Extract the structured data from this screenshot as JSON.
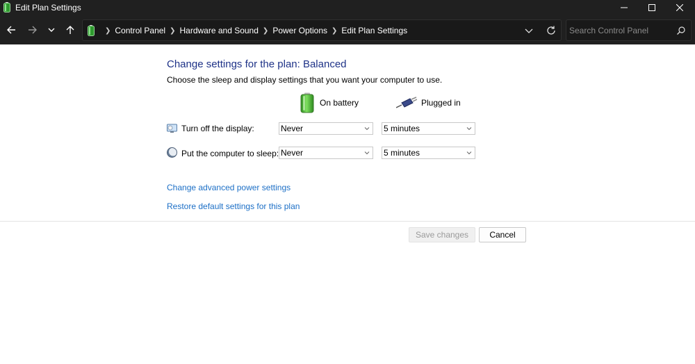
{
  "window": {
    "title": "Edit Plan Settings",
    "icon": "battery-plan-icon"
  },
  "nav": {
    "breadcrumbs": [
      "Control Panel",
      "Hardware and Sound",
      "Power Options",
      "Edit Plan Settings"
    ],
    "search_placeholder": "Search Control Panel"
  },
  "content": {
    "heading": "Change settings for the plan: Balanced",
    "description": "Choose the sleep and display settings that you want your computer to use.",
    "columns": {
      "battery": "On battery",
      "plugged": "Plugged in"
    },
    "rows": [
      {
        "label": "Turn off the display:",
        "battery": "Never",
        "plugged": "5 minutes",
        "icon": "display-icon"
      },
      {
        "label": "Put the computer to sleep:",
        "battery": "Never",
        "plugged": "5 minutes",
        "icon": "sleep-moon-icon"
      }
    ],
    "links": {
      "advanced": "Change advanced power settings",
      "restore": "Restore default settings for this plan"
    }
  },
  "buttons": {
    "save": "Save changes",
    "cancel": "Cancel"
  },
  "colors": {
    "chrome_dark": "#202020",
    "heading_blue": "#1e3287",
    "link_blue": "#1c6fc6"
  }
}
